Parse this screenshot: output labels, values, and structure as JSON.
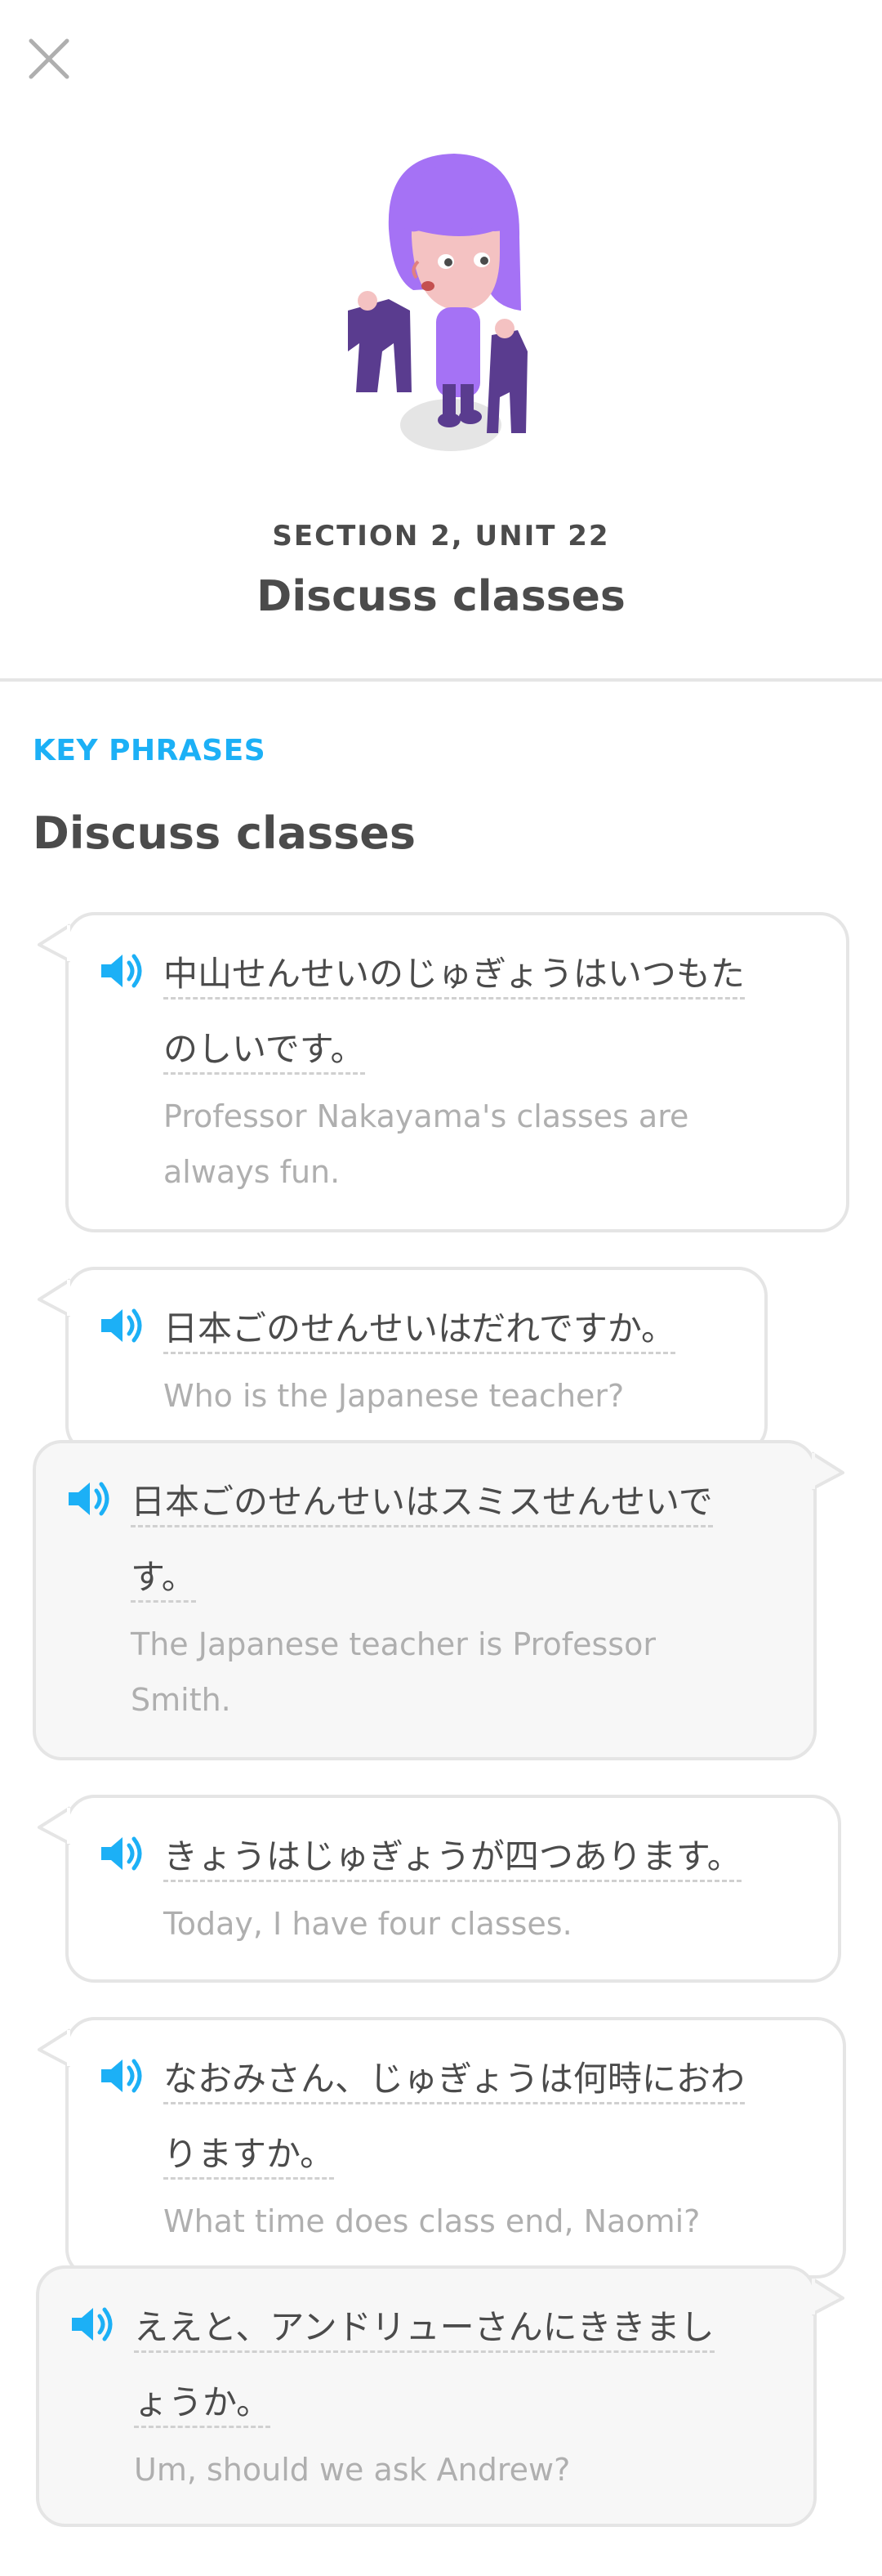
{
  "header": {
    "close_icon": "close-icon",
    "section_label": "SECTION 2, UNIT 22",
    "unit_title": "Discuss classes"
  },
  "key_phrases": {
    "label": "KEY PHRASES",
    "title": "Discuss classes"
  },
  "colors": {
    "accent_blue": "#1cb0f6",
    "text_dark": "#4b4b4b",
    "text_muted": "#afafaf",
    "border": "#e5e5e5",
    "mascot_hair": "#a572f5",
    "mascot_clothes": "#5a3c8f"
  },
  "phrases": [
    {
      "jp_lines": [
        "中山せんせいのじゅぎょうはいつもた",
        "のしいです。"
      ],
      "en_lines": [
        "Professor Nakayama's classes are",
        "always fun."
      ]
    },
    {
      "jp_lines": [
        "日本ごのせんせいはだれですか。"
      ],
      "en_lines": [
        "Who is the Japanese teacher?"
      ]
    },
    {
      "jp_lines": [
        "日本ごのせんせいはスミスせんせいで",
        "す。"
      ],
      "en_lines": [
        "The Japanese teacher is Professor",
        "Smith."
      ]
    },
    {
      "jp_lines": [
        "きょうはじゅぎょうが四つあります。"
      ],
      "en_lines": [
        "Today, I have four classes."
      ]
    },
    {
      "jp_lines": [
        "なおみさん、じゅぎょうは何時におわ",
        "りますか。"
      ],
      "en_lines": [
        "What time does class end, Naomi?"
      ]
    },
    {
      "jp_lines": [
        "ええと、アンドリューさんにききまし",
        "ょうか。"
      ],
      "en_lines": [
        "Um, should we ask Andrew?"
      ]
    }
  ]
}
